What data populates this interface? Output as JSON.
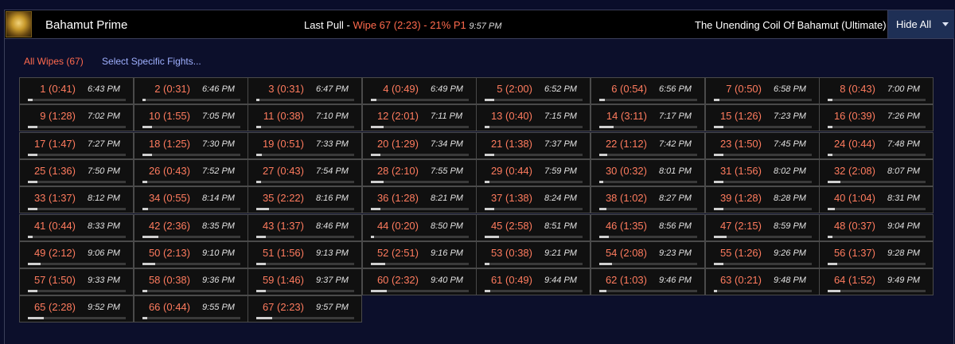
{
  "header": {
    "boss_name": "Bahamut Prime",
    "last_pull_label": "Last Pull -",
    "last_pull_result": "Wipe 67 (2:23) - 21% P1",
    "last_pull_time": "9:57 PM",
    "zone": "The Unending Coil Of Bahamut (Ultimate)",
    "hide_all": "Hide All"
  },
  "filters": {
    "all_wipes": "All Wipes (67)",
    "select_specific": "Select Specific Fights..."
  },
  "colors": {
    "wipe": "#ff6a4d",
    "link": "#9fb0ff",
    "header_bg": "#000000",
    "button_bg": "#1e2f55"
  },
  "fights": [
    {
      "label": "1 (0:41)",
      "time": "6:43 PM",
      "progress": 0.05
    },
    {
      "label": "2 (0:31)",
      "time": "6:46 PM",
      "progress": 0.03
    },
    {
      "label": "3 (0:31)",
      "time": "6:47 PM",
      "progress": 0.03
    },
    {
      "label": "4 (0:49)",
      "time": "6:49 PM",
      "progress": 0.06
    },
    {
      "label": "5 (2:00)",
      "time": "6:52 PM",
      "progress": 0.1
    },
    {
      "label": "6 (0:54)",
      "time": "6:56 PM",
      "progress": 0.06
    },
    {
      "label": "7 (0:50)",
      "time": "6:58 PM",
      "progress": 0.06
    },
    {
      "label": "8 (0:43)",
      "time": "7:00 PM",
      "progress": 0.05
    },
    {
      "label": "9 (1:28)",
      "time": "7:02 PM",
      "progress": 0.1
    },
    {
      "label": "10 (1:55)",
      "time": "7:05 PM",
      "progress": 0.1
    },
    {
      "label": "11 (0:38)",
      "time": "7:10 PM",
      "progress": 0.05
    },
    {
      "label": "12 (2:01)",
      "time": "7:11 PM",
      "progress": 0.13
    },
    {
      "label": "13 (0:40)",
      "time": "7:15 PM",
      "progress": 0.05
    },
    {
      "label": "14 (3:11)",
      "time": "7:17 PM",
      "progress": 0.15
    },
    {
      "label": "15 (1:26)",
      "time": "7:23 PM",
      "progress": 0.1
    },
    {
      "label": "16 (0:39)",
      "time": "7:26 PM",
      "progress": 0.05
    },
    {
      "label": "17 (1:47)",
      "time": "7:27 PM",
      "progress": 0.1
    },
    {
      "label": "18 (1:25)",
      "time": "7:30 PM",
      "progress": 0.1
    },
    {
      "label": "19 (0:51)",
      "time": "7:33 PM",
      "progress": 0.06
    },
    {
      "label": "20 (1:29)",
      "time": "7:34 PM",
      "progress": 0.1
    },
    {
      "label": "21 (1:38)",
      "time": "7:37 PM",
      "progress": 0.1
    },
    {
      "label": "22 (1:12)",
      "time": "7:42 PM",
      "progress": 0.08
    },
    {
      "label": "23 (1:50)",
      "time": "7:45 PM",
      "progress": 0.1
    },
    {
      "label": "24 (0:44)",
      "time": "7:48 PM",
      "progress": 0.05
    },
    {
      "label": "25 (1:36)",
      "time": "7:50 PM",
      "progress": 0.1
    },
    {
      "label": "26 (0:43)",
      "time": "7:52 PM",
      "progress": 0.05
    },
    {
      "label": "27 (0:43)",
      "time": "7:54 PM",
      "progress": 0.05
    },
    {
      "label": "28 (2:10)",
      "time": "7:55 PM",
      "progress": 0.13
    },
    {
      "label": "29 (0:44)",
      "time": "7:59 PM",
      "progress": 0.05
    },
    {
      "label": "30 (0:32)",
      "time": "8:01 PM",
      "progress": 0.04
    },
    {
      "label": "31 (1:56)",
      "time": "8:02 PM",
      "progress": 0.1
    },
    {
      "label": "32 (2:08)",
      "time": "8:07 PM",
      "progress": 0.13
    },
    {
      "label": "33 (1:37)",
      "time": "8:12 PM",
      "progress": 0.1
    },
    {
      "label": "34 (0:55)",
      "time": "8:14 PM",
      "progress": 0.06
    },
    {
      "label": "35 (2:22)",
      "time": "8:16 PM",
      "progress": 0.13
    },
    {
      "label": "36 (1:28)",
      "time": "8:21 PM",
      "progress": 0.1
    },
    {
      "label": "37 (1:38)",
      "time": "8:24 PM",
      "progress": 0.1
    },
    {
      "label": "38 (1:02)",
      "time": "8:27 PM",
      "progress": 0.07
    },
    {
      "label": "39 (1:28)",
      "time": "8:28 PM",
      "progress": 0.1
    },
    {
      "label": "40 (1:04)",
      "time": "8:31 PM",
      "progress": 0.07
    },
    {
      "label": "41 (0:44)",
      "time": "8:33 PM",
      "progress": 0.05
    },
    {
      "label": "42 (2:36)",
      "time": "8:35 PM",
      "progress": 0.16
    },
    {
      "label": "43 (1:37)",
      "time": "8:46 PM",
      "progress": 0.1
    },
    {
      "label": "44 (0:20)",
      "time": "8:50 PM",
      "progress": 0.03
    },
    {
      "label": "45 (2:58)",
      "time": "8:51 PM",
      "progress": 0.15
    },
    {
      "label": "46 (1:35)",
      "time": "8:56 PM",
      "progress": 0.1
    },
    {
      "label": "47 (2:15)",
      "time": "8:59 PM",
      "progress": 0.13
    },
    {
      "label": "48 (0:37)",
      "time": "9:04 PM",
      "progress": 0.05
    },
    {
      "label": "49 (2:12)",
      "time": "9:06 PM",
      "progress": 0.13
    },
    {
      "label": "50 (2:13)",
      "time": "9:10 PM",
      "progress": 0.13
    },
    {
      "label": "51 (1:56)",
      "time": "9:13 PM",
      "progress": 0.1
    },
    {
      "label": "52 (2:51)",
      "time": "9:16 PM",
      "progress": 0.15
    },
    {
      "label": "53 (0:38)",
      "time": "9:21 PM",
      "progress": 0.05
    },
    {
      "label": "54 (2:08)",
      "time": "9:23 PM",
      "progress": 0.13
    },
    {
      "label": "55 (1:26)",
      "time": "9:26 PM",
      "progress": 0.1
    },
    {
      "label": "56 (1:37)",
      "time": "9:28 PM",
      "progress": 0.1
    },
    {
      "label": "57 (1:50)",
      "time": "9:33 PM",
      "progress": 0.1
    },
    {
      "label": "58 (0:38)",
      "time": "9:36 PM",
      "progress": 0.05
    },
    {
      "label": "59 (1:46)",
      "time": "9:37 PM",
      "progress": 0.1
    },
    {
      "label": "60 (2:32)",
      "time": "9:40 PM",
      "progress": 0.16
    },
    {
      "label": "61 (0:49)",
      "time": "9:44 PM",
      "progress": 0.06
    },
    {
      "label": "62 (1:03)",
      "time": "9:46 PM",
      "progress": 0.07
    },
    {
      "label": "63 (0:21)",
      "time": "9:48 PM",
      "progress": 0.03
    },
    {
      "label": "64 (1:52)",
      "time": "9:49 PM",
      "progress": 0.13
    },
    {
      "label": "65 (2:28)",
      "time": "9:52 PM",
      "progress": 0.16
    },
    {
      "label": "66 (0:44)",
      "time": "9:55 PM",
      "progress": 0.05
    },
    {
      "label": "67 (2:23)",
      "time": "9:57 PM",
      "progress": 0.16
    }
  ]
}
